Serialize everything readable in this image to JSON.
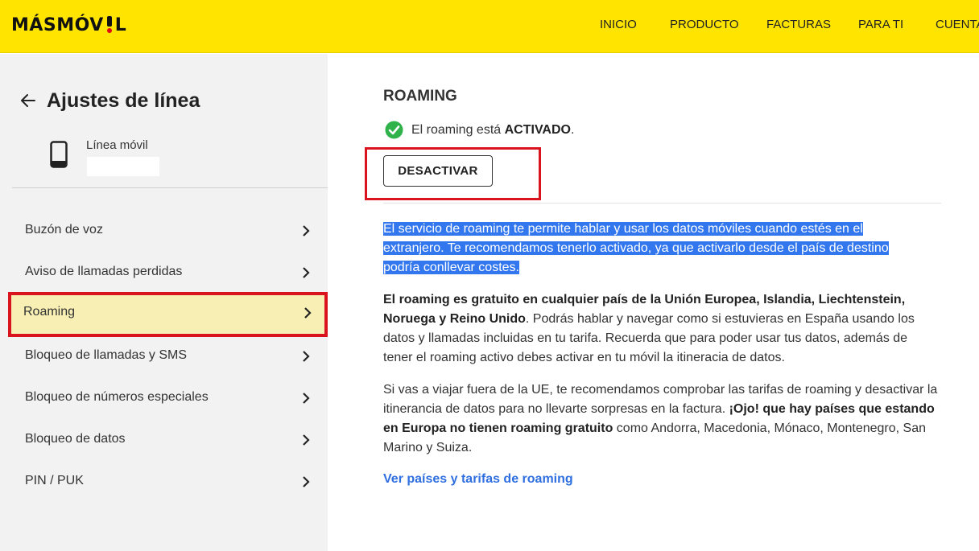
{
  "header": {
    "logo_text_a": "MÁSMÓV",
    "logo_text_b": "L",
    "nav": [
      "INICIO",
      "PRODUCTO",
      "FACTURAS",
      "PARA TI",
      "CUENTA"
    ]
  },
  "sidebar": {
    "title": "Ajustes de línea",
    "line_label": "Línea móvil",
    "line_number": "",
    "items": [
      {
        "label": "Buzón de voz"
      },
      {
        "label": "Aviso de llamadas perdidas"
      },
      {
        "label": "Roaming",
        "active": true
      },
      {
        "label": "Bloqueo de llamadas y SMS"
      },
      {
        "label": "Bloqueo de números especiales"
      },
      {
        "label": "Bloqueo de datos"
      },
      {
        "label": "PIN / PUK"
      }
    ]
  },
  "main": {
    "title": "ROAMING",
    "status_prefix": "El roaming está ",
    "status_value": "ACTIVADO",
    "status_suffix": ".",
    "button_label": "DESACTIVAR",
    "para1_lines": [
      "El servicio de roaming te permite hablar y usar los datos móviles cuando estés en el",
      "extranjero. Te recomendamos tenerlo activado, ya que activarlo desde el país de destino",
      "podría conllevar costes."
    ],
    "para2_bold": "El roaming es gratuito en cualquier país de la Unión Europea, Islandia, Liechtenstein, Noruega y Reino Unido",
    "para2_rest": ". Podrás hablar y navegar como si estuvieras en España usando los datos y llamadas incluidas en tu tarifa. Recuerda que para poder usar tus datos, además de tener el roaming activo debes activar en tu móvil la itineracia de datos.",
    "para3_a": "Si vas a viajar fuera de la UE, te recomendamos comprobar las tarifas de roaming y desactivar la itinerancia de datos para no llevarte sorpresas en la factura. ",
    "para3_bold": "¡Ojo! que hay países que estando en Europa no tienen roaming gratuito",
    "para3_b": " como Andorra, Macedonia, Mónaco, Montenegro, San Marino y Suiza.",
    "link_text": "Ver países y tarifas de roaming"
  },
  "colors": {
    "brand_yellow": "#ffe400",
    "check_green": "#2fb24a",
    "highlight_red": "#d9141f",
    "link_blue": "#2f6fe0",
    "selection_blue": "#3377ee"
  },
  "icons": [
    "back-arrow-icon",
    "phone-icon",
    "chevron-right-icon",
    "check-circle-icon"
  ]
}
